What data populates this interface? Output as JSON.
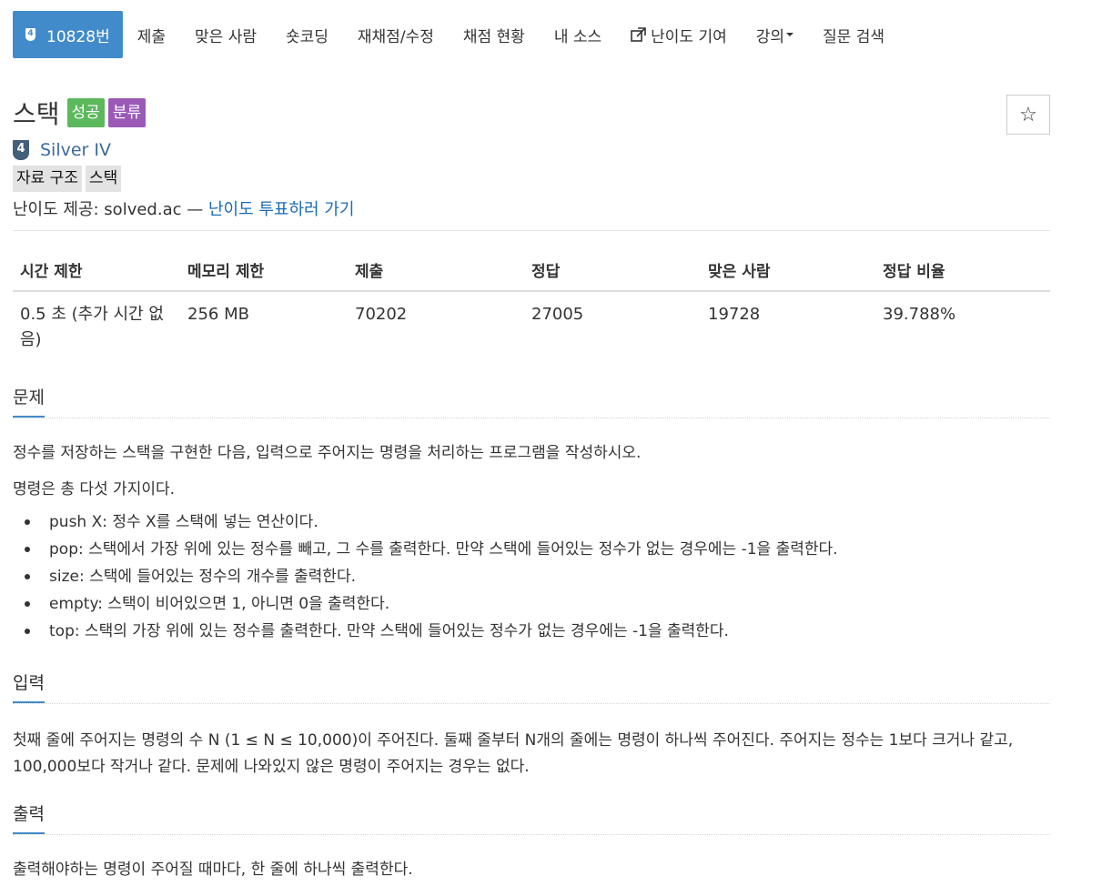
{
  "nav": {
    "problem_id": "10828번",
    "problem_badge": "4",
    "items": [
      "제출",
      "맞은 사람",
      "숏코딩",
      "재채점/수정",
      "채점 현황",
      "내 소스"
    ],
    "difficulty_contrib": "난이도 기여",
    "lecture": "강의",
    "question_search": "질문 검색"
  },
  "problem": {
    "title": "스택",
    "badge_success": "성공",
    "badge_category": "분류",
    "star": "☆",
    "tier_number": "4",
    "tier_name": "Silver IV",
    "tags": [
      "자료 구조",
      "스택"
    ],
    "provider_prefix": "난이도 제공: solved.ac —",
    "vote_link": "난이도 투표하러 가기"
  },
  "stats": {
    "headers": [
      "시간 제한",
      "메모리 제한",
      "제출",
      "정답",
      "맞은 사람",
      "정답 비율"
    ],
    "values": [
      "0.5 초 (추가 시간 없음)",
      "256 MB",
      "70202",
      "27005",
      "19728",
      "39.788%"
    ]
  },
  "sections": {
    "description": {
      "title": "문제",
      "p1": "정수를 저장하는 스택을 구현한 다음, 입력으로 주어지는 명령을 처리하는 프로그램을 작성하시오.",
      "p2": "명령은 총 다섯 가지이다.",
      "bullets": [
        "push X: 정수 X를 스택에 넣는 연산이다.",
        "pop: 스택에서 가장 위에 있는 정수를 빼고, 그 수를 출력한다. 만약 스택에 들어있는 정수가 없는 경우에는 -1을 출력한다.",
        "size: 스택에 들어있는 정수의 개수를 출력한다.",
        "empty: 스택이 비어있으면 1, 아니면 0을 출력한다.",
        "top: 스택의 가장 위에 있는 정수를 출력한다. 만약 스택에 들어있는 정수가 없는 경우에는 -1을 출력한다."
      ]
    },
    "input": {
      "title": "입력",
      "text": "첫째 줄에 주어지는 명령의 수 N (1 ≤ N ≤ 10,000)이 주어진다. 둘째 줄부터 N개의 줄에는 명령이 하나씩 주어진다. 주어지는 정수는 1보다 크거나 같고, 100,000보다 작거나 같다. 문제에 나와있지 않은 명령이 주어지는 경우는 없다."
    },
    "output": {
      "title": "출력",
      "text": "출력해야하는 명령이 주어질 때마다, 한 줄에 하나씩 출력한다."
    }
  }
}
